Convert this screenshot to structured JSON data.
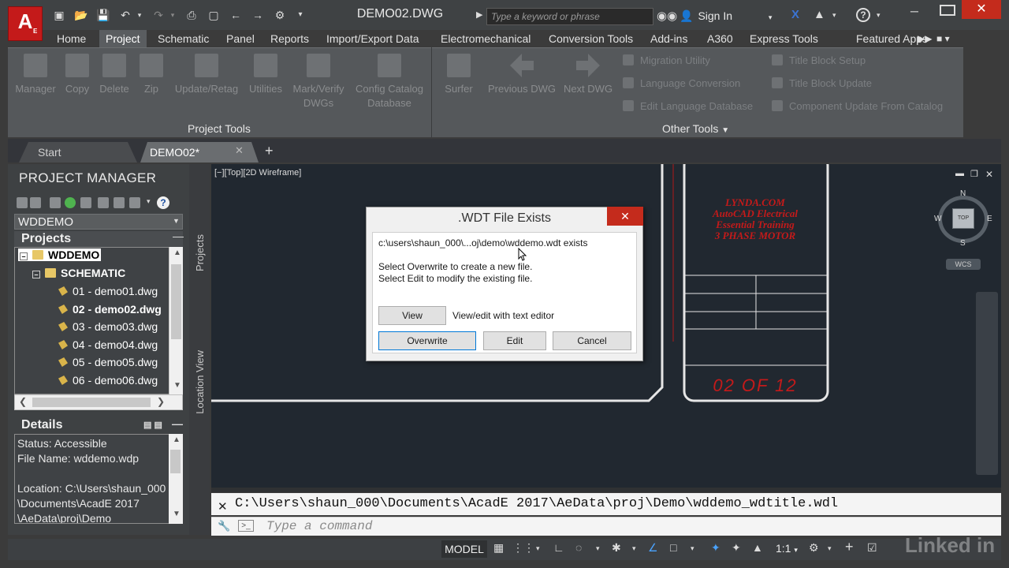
{
  "title_bar": {
    "logo_letter": "A",
    "logo_sub": "E",
    "doc_title": "DEMO02.DWG",
    "search_placeholder": "Type a keyword or phrase",
    "sign_in": "Sign In"
  },
  "ribbon": {
    "tabs": [
      "Home",
      "Project",
      "Schematic",
      "Panel",
      "Reports",
      "Import/Export Data",
      "Electromechanical",
      "Conversion Tools",
      "Add-ins",
      "A360",
      "Express Tools",
      "Featured Apps"
    ],
    "active_tab": "Project",
    "project_tools": {
      "buttons": [
        "Manager",
        "Copy",
        "Delete",
        "Zip",
        "Update/Retag",
        "Utilities",
        "Mark/Verify DWGs",
        "Config Catalog Database"
      ],
      "label": "Project Tools"
    },
    "other_tools": {
      "buttons": [
        "Surfer",
        "Previous DWG",
        "Next DWG"
      ],
      "small_buttons": [
        "Migration Utility",
        "Language Conversion",
        "Edit Language Database",
        "Title Block Setup",
        "Title Block Update",
        "Component Update From Catalog"
      ],
      "label": "Other Tools"
    }
  },
  "file_tabs": {
    "start": "Start",
    "current": "DEMO02*"
  },
  "project_manager": {
    "title": "PROJECT MANAGER",
    "selected_project": "WDDEMO",
    "projects_header": "Projects",
    "tree": {
      "root": "WDDEMO",
      "folder": "SCHEMATIC",
      "files": [
        "01 - demo01.dwg",
        "02 - demo02.dwg",
        "03 - demo03.dwg",
        "04 - demo04.dwg",
        "05 - demo05.dwg",
        "06 - demo06.dwg"
      ],
      "active_file_index": 1
    },
    "details_header": "Details",
    "details": {
      "status": "Status: Accessible",
      "file_name": "File Name: wddemo.wdp",
      "location_1": "Location: C:\\Users\\shaun_000",
      "location_2": "\\Documents\\AcadE 2017",
      "location_3": "\\AeData\\proj\\Demo"
    },
    "side_tabs": [
      "Projects",
      "Location View"
    ]
  },
  "viewport": {
    "view_controls": "[−][Top][2D Wireframe]",
    "viewcube": {
      "top": "TOP",
      "n": "N",
      "s": "S",
      "e": "E",
      "w": "W",
      "wcs": "WCS"
    },
    "title_block": {
      "line1": "LYNDA.COM",
      "line2": "AutoCAD Electrical",
      "line3": "Essential Training",
      "line4": "3 PHASE MOTOR",
      "sheet": "02 OF 12"
    }
  },
  "dialog": {
    "title": ".WDT File Exists",
    "path_text": "c:\\users\\shaun_000\\...oj\\demo\\wddemo.wdt exists",
    "msg1": "Select Overwrite to create a new file.",
    "msg2": "Select Edit to modify the existing file.",
    "view_button": "View",
    "view_desc": "View/edit with text editor",
    "overwrite_button": "Overwrite",
    "edit_button": "Edit",
    "cancel_button": "Cancel"
  },
  "command": {
    "history": "C:\\Users\\shaun_000\\Documents\\AcadE 2017\\AeData\\proj\\Demo\\wddemo_wdtitle.wdl",
    "placeholder": "Type a command"
  },
  "status_bar": {
    "model": "MODEL",
    "scale": "1:1"
  },
  "colors": {
    "logo_red": "#c41a1a",
    "close_red": "#c42b1c",
    "titleblock_red": "#c41a1a",
    "default_button_blue": "#0078d7"
  }
}
